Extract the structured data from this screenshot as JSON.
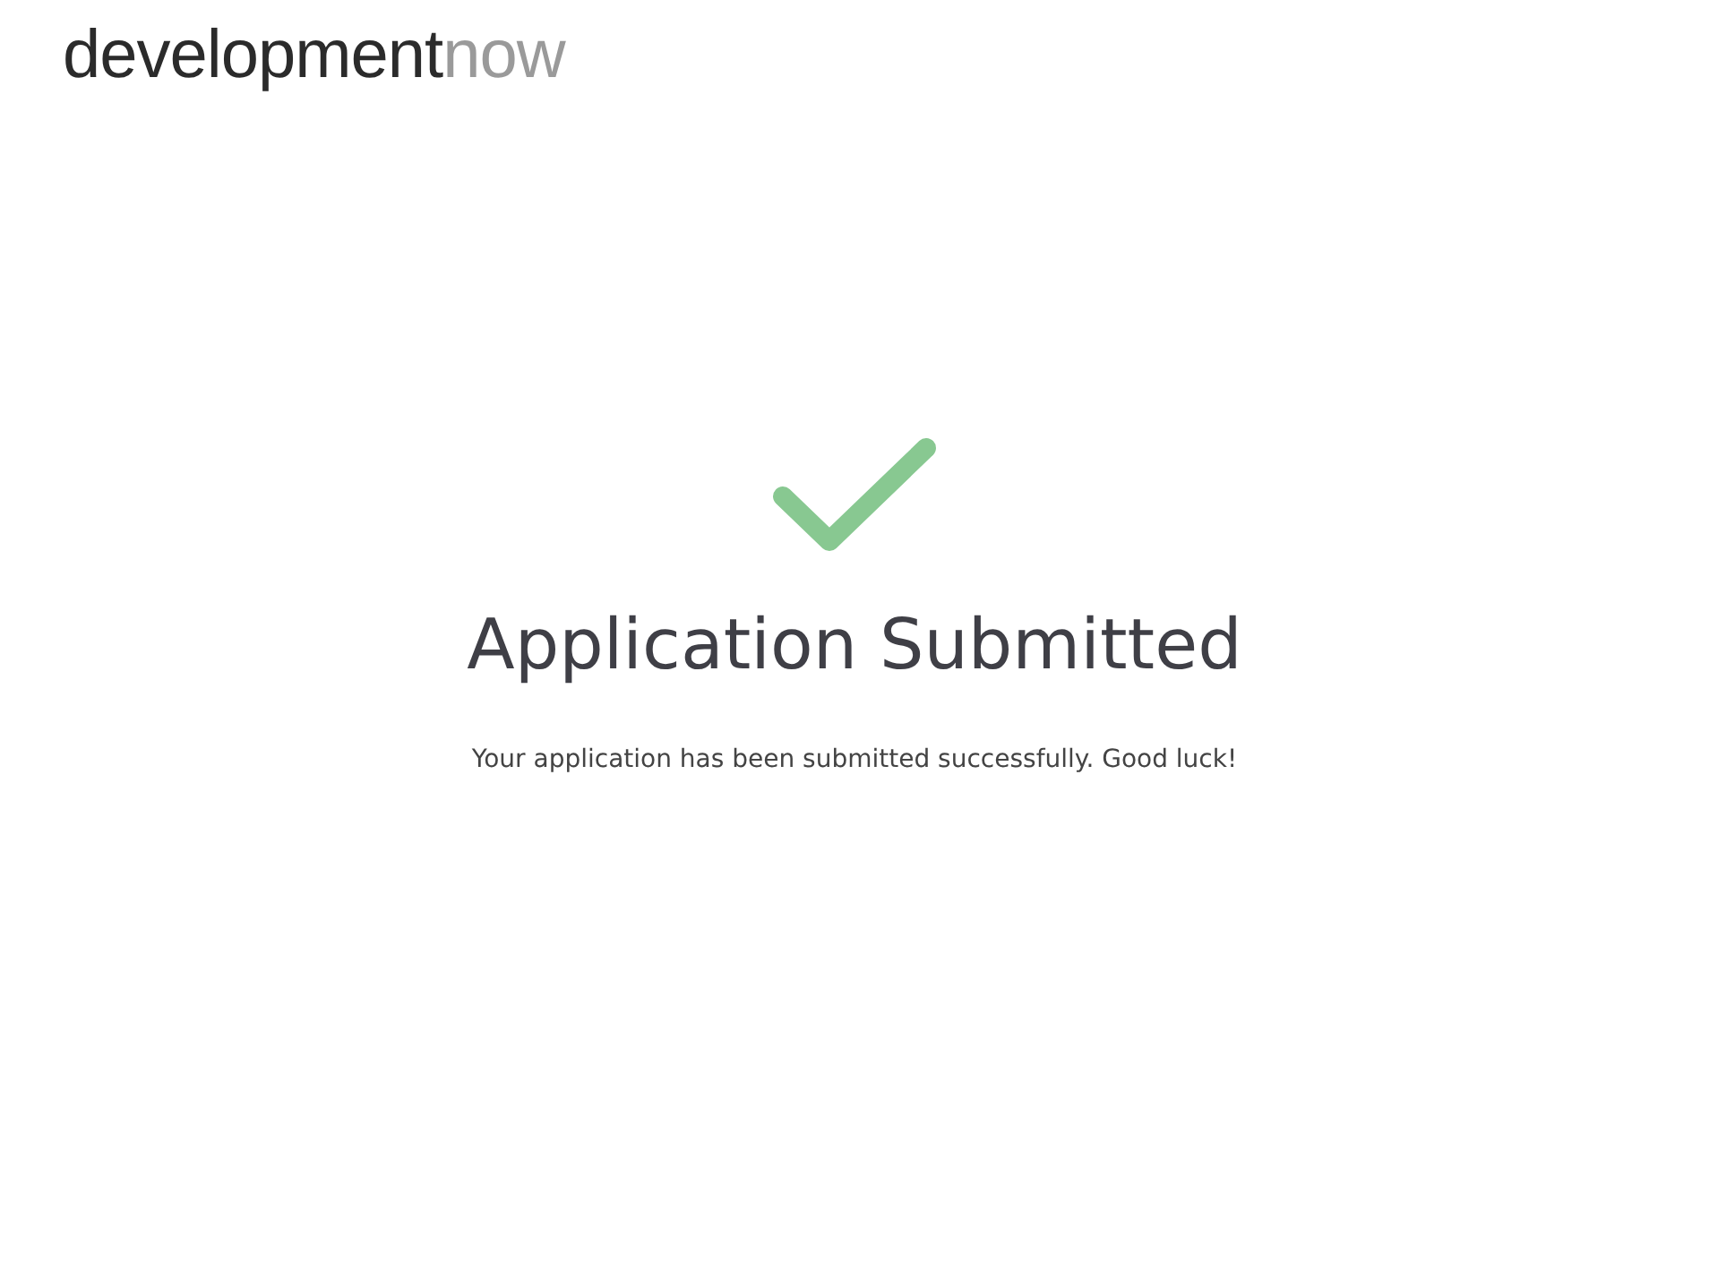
{
  "logo": {
    "primary": "development",
    "secondary": "now"
  },
  "confirmation": {
    "title": "Application Submitted",
    "message": "Your application has been submitted successfully. Good luck!"
  }
}
